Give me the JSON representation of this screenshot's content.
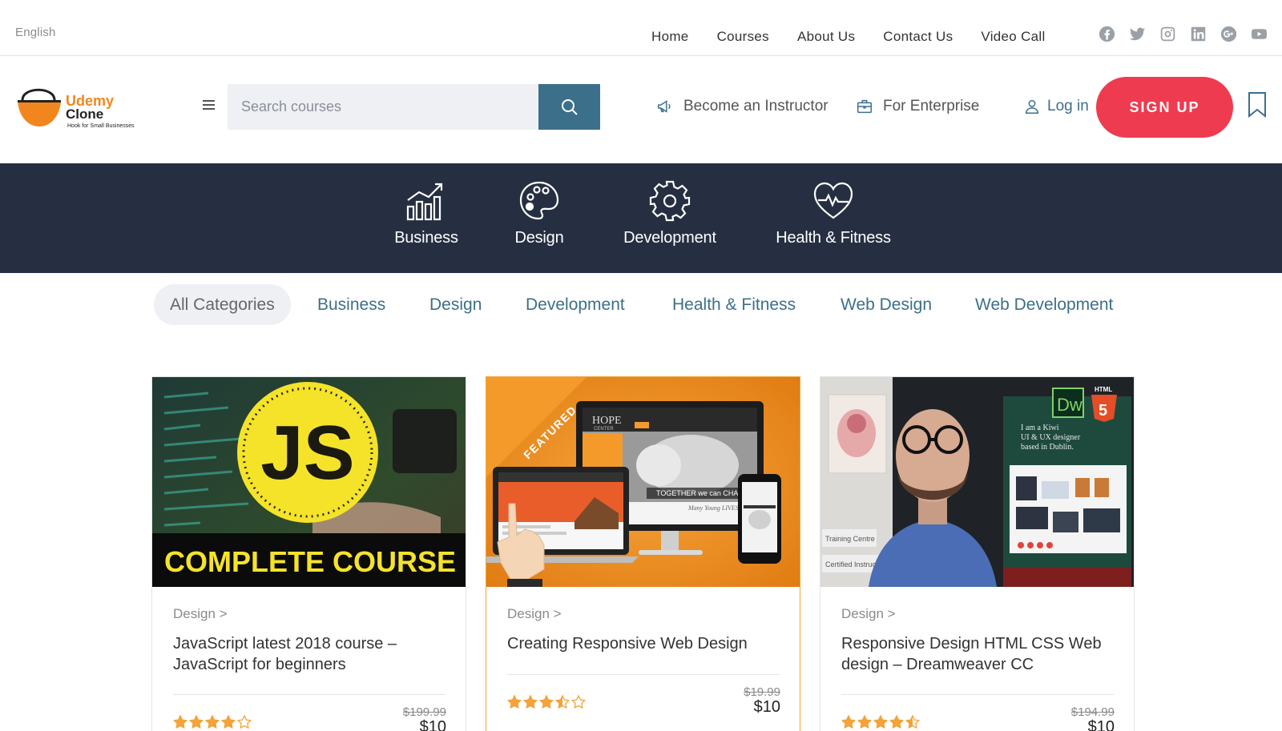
{
  "topbar": {
    "language": "English",
    "nav": [
      "Home",
      "Courses",
      "About Us",
      "Contact Us",
      "Video Call"
    ],
    "socials": [
      "facebook-icon",
      "twitter-icon",
      "instagram-icon",
      "linkedin-icon",
      "google-plus-icon",
      "youtube-icon"
    ]
  },
  "header": {
    "logo": {
      "line1": "Udemy",
      "line2": "Clone",
      "tagline": "Hook for Small Businesses"
    },
    "search": {
      "placeholder": "Search courses"
    },
    "become_instructor": "Become an Instructor",
    "for_enterprise": "For Enterprise",
    "login": "Log in",
    "signup": "SIGN UP"
  },
  "categories_band": [
    {
      "label": "Business",
      "icon": "chart-growth-icon"
    },
    {
      "label": "Design",
      "icon": "palette-icon"
    },
    {
      "label": "Development",
      "icon": "gear-icon"
    },
    {
      "label": "Health & Fitness",
      "icon": "heart-pulse-icon"
    }
  ],
  "filter_tabs": [
    "All Categories",
    "Business",
    "Design",
    "Development",
    "Health & Fitness",
    "Web Design",
    "Web Development"
  ],
  "active_tab": "All Categories",
  "colors": {
    "accent": "#3c6f8a",
    "signup": "#ee3b50",
    "band": "#262f42",
    "brand_orange": "#f1861f",
    "star": "#f4a23a"
  },
  "courses": [
    {
      "category": "Design >",
      "title": "JavaScript latest 2018 course – JavaScript for beginners",
      "image_text": {
        "badge": "JS",
        "banner": "COMPLETE COURSE"
      },
      "rating": 4,
      "old_price": "$199.99",
      "price": "$10",
      "featured": false
    },
    {
      "category": "Design >",
      "title": "Creating Responsive Web Design",
      "image_text": {
        "ribbon": "FEATURED",
        "brand": "HOPE",
        "brand_sub": "CENTER",
        "tagline": "TOGETHER we can CHANG",
        "subline": "Many Young LIVES"
      },
      "rating": 3.5,
      "old_price": "$19.99",
      "price": "$10",
      "featured": true
    },
    {
      "category": "Design >",
      "title": "Responsive Design HTML CSS Web design – Dreamweaver CC",
      "image_text": {
        "dw": "Dw",
        "html": "HTML",
        "h5": "5",
        "quote1": "I am a Kiwi",
        "quote2": "UI & UX designer",
        "quote3": "based in Dublin.",
        "tag1": "Training Centre",
        "tag2": "Certified Instructor"
      },
      "rating": 4.5,
      "old_price": "$194.99",
      "price": "$10",
      "featured": false
    }
  ]
}
